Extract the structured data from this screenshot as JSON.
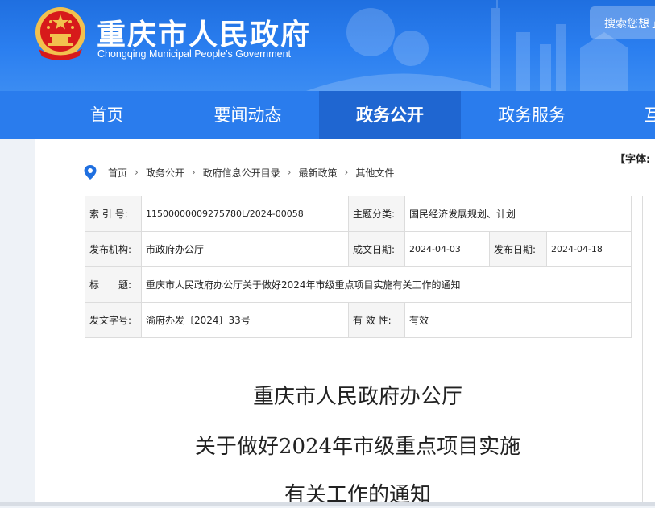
{
  "header": {
    "title": "重庆市人民政府",
    "subtitle": "Chongqing Municipal People's Government",
    "search_placeholder": "搜索您想了"
  },
  "nav": {
    "items": [
      {
        "label": "首页",
        "active": false
      },
      {
        "label": "要闻动态",
        "active": false
      },
      {
        "label": "政务公开",
        "active": true
      },
      {
        "label": "政务服务",
        "active": false
      },
      {
        "label": "互",
        "active": false
      }
    ]
  },
  "font_size_label": "【字体:",
  "breadcrumb": [
    "首页",
    "政务公开",
    "政府信息公开目录",
    "最新政策",
    "其他文件"
  ],
  "meta": {
    "index_label": "索 引 号:",
    "index_value": "11500000009275780L/2024-00058",
    "topic_label": "主题分类:",
    "topic_value": "国民经济发展规划、计划",
    "issuer_label": "发布机构:",
    "issuer_value": "市政府办公厅",
    "created_label": "成文日期:",
    "created_value": "2024-04-03",
    "published_label": "发布日期:",
    "published_value": "2024-04-18",
    "title_label": "标　　题:",
    "title_value": "重庆市人民政府办公厅关于做好2024年市级重点项目实施有关工作的通知",
    "docno_label": "发文字号:",
    "docno_value": "渝府办发〔2024〕33号",
    "validity_label": "有 效 性:",
    "validity_value": "有效"
  },
  "document": {
    "title_line1": "重庆市人民政府办公厅",
    "title_line2": "关于做好2024年市级重点项目实施",
    "title_line3": "有关工作的通知"
  },
  "colors": {
    "header_blue": "#2b7ff0",
    "nav_blue": "#2a7ced",
    "nav_active": "#1f66d1",
    "emblem_red": "#d71a1b",
    "emblem_gold": "#f2c14e"
  }
}
